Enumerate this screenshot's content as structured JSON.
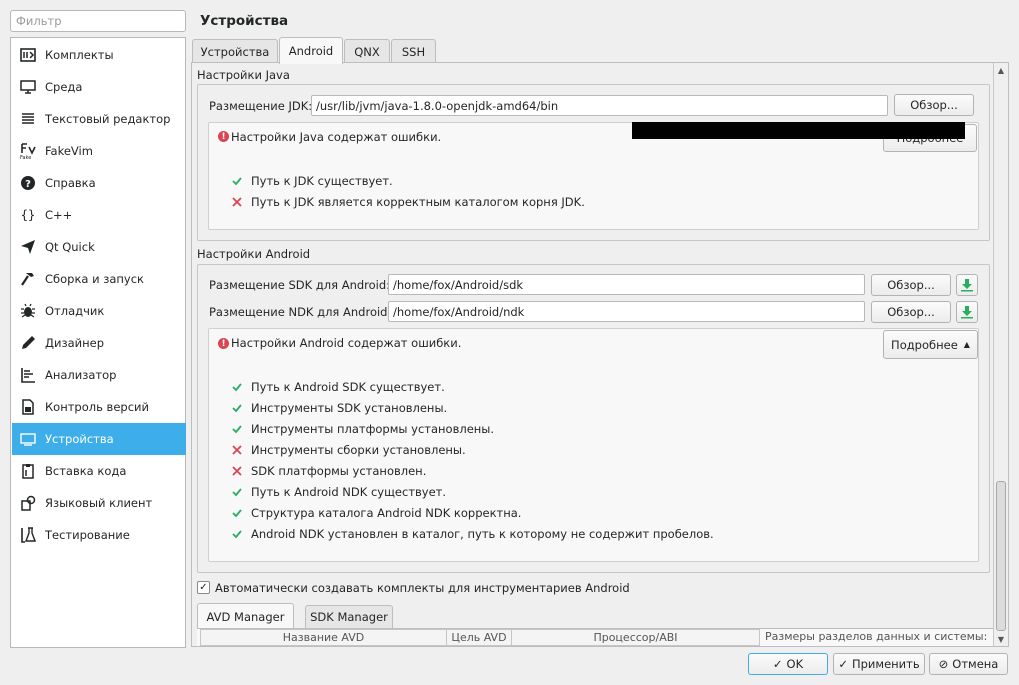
{
  "filter": {
    "placeholder": "Фильтр"
  },
  "sidebar": {
    "items": [
      {
        "label": "Комплекты",
        "icon": "kits-icon"
      },
      {
        "label": "Среда",
        "icon": "monitor-icon"
      },
      {
        "label": "Текстовый редактор",
        "icon": "text-editor-icon"
      },
      {
        "label": "FakeVim",
        "icon": "fakevim-icon"
      },
      {
        "label": "Справка",
        "icon": "help-icon"
      },
      {
        "label": "C++",
        "icon": "braces-icon"
      },
      {
        "label": "Qt Quick",
        "icon": "qtquick-icon"
      },
      {
        "label": "Сборка и запуск",
        "icon": "hammer-icon"
      },
      {
        "label": "Отладчик",
        "icon": "bug-icon"
      },
      {
        "label": "Дизайнер",
        "icon": "pencil-icon"
      },
      {
        "label": "Анализатор",
        "icon": "analyzer-icon"
      },
      {
        "label": "Контроль версий",
        "icon": "version-control-icon"
      },
      {
        "label": "Устройства",
        "icon": "devices-icon",
        "active": true
      },
      {
        "label": "Вставка кода",
        "icon": "clipboard-icon"
      },
      {
        "label": "Языковый клиент",
        "icon": "language-client-icon"
      },
      {
        "label": "Тестирование",
        "icon": "flask-icon"
      }
    ]
  },
  "page": {
    "title": "Устройства"
  },
  "tabs": [
    {
      "label": "Устройства"
    },
    {
      "label": "Android",
      "active": true
    },
    {
      "label": "QNX"
    },
    {
      "label": "SSH"
    }
  ],
  "java": {
    "group_title": "Настройки Java",
    "jdk_label": "Размещение JDK:",
    "jdk_value": "/usr/lib/jvm/java-1.8.0-openjdk-amd64/bin",
    "browse_label": "Обзор...",
    "error_text": "Настройки Java содержат ошибки.",
    "details_label": "Подробнее",
    "checks": [
      {
        "text": "Путь к JDK существует.",
        "ok": true
      },
      {
        "text": "Путь к JDK является корректным каталогом корня JDK.",
        "ok": false
      }
    ]
  },
  "android": {
    "group_title": "Настройки Android",
    "sdk_label": "Размещение SDK для Android:",
    "sdk_value": "/home/fox/Android/sdk",
    "ndk_label": "Размещение NDK для Android:",
    "ndk_value": "/home/fox/Android/ndk",
    "browse_label": "Обзор...",
    "error_text": "Настройки Android содержат ошибки.",
    "details_label": "Подробнее",
    "checks": [
      {
        "text": "Путь к Android SDK существует.",
        "ok": true
      },
      {
        "text": "Инструменты SDK установлены.",
        "ok": true
      },
      {
        "text": "Инструменты платформы установлены.",
        "ok": true
      },
      {
        "text": "Инструменты сборки установлены.",
        "ok": false
      },
      {
        "text": "SDK платформы установлен.",
        "ok": false
      },
      {
        "text": "Путь к Android NDK существует.",
        "ok": true
      },
      {
        "text": "Структура каталога Android NDK корректна.",
        "ok": true
      },
      {
        "text": "Android NDK установлен в каталог, путь к которому не содержит пробелов.",
        "ok": true
      }
    ],
    "auto_kits_label": "Автоматически создавать комплекты для инструментариев Android",
    "auto_kits_checked": true
  },
  "avd": {
    "tabs": [
      {
        "label": "AVD Manager",
        "active": true
      },
      {
        "label": "SDK Manager"
      }
    ],
    "columns": [
      "Название AVD",
      "Цель AVD",
      "Процессор/ABI"
    ],
    "partition_label": "Размеры разделов данных и системы:"
  },
  "footer": {
    "ok_label": "OK",
    "apply_label": "Применить",
    "cancel_label": "Отмена"
  },
  "colors": {
    "accent": "#3daee9",
    "ok": "#27ae60",
    "error": "#da4453"
  }
}
